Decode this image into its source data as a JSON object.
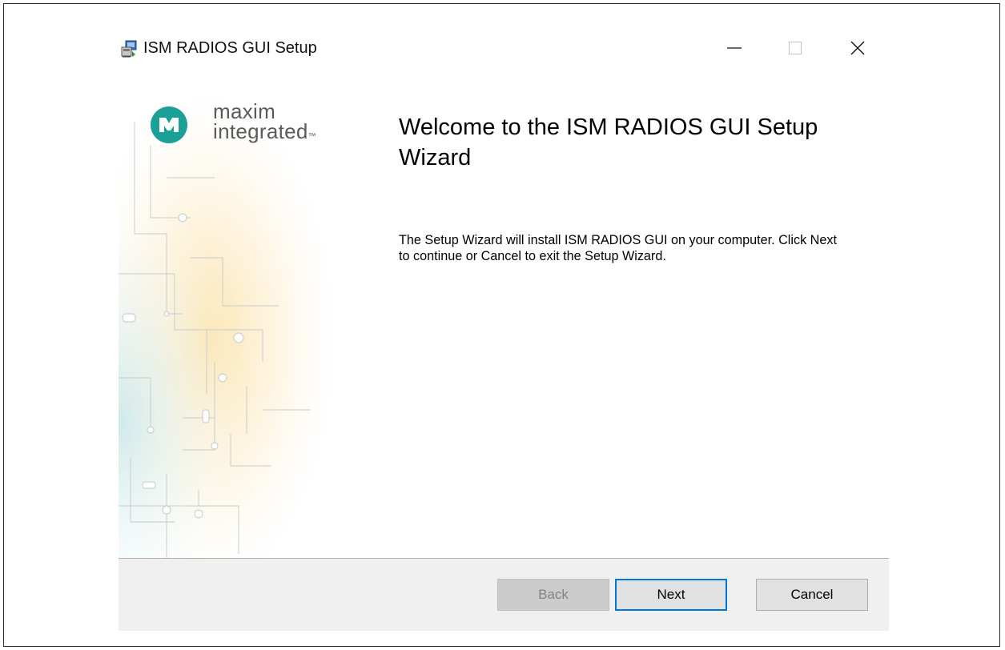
{
  "window": {
    "title": "ISM RADIOS GUI Setup",
    "controls": {
      "minimize": "minimize-icon",
      "maximize": "maximize-icon",
      "close": "close-icon"
    }
  },
  "branding": {
    "logo_line1": "maxim",
    "logo_line2": "integrated",
    "trademark": "™",
    "logo_color": "#1aa097"
  },
  "content": {
    "title": "Welcome to the ISM RADIOS GUI Setup Wizard",
    "body": "The Setup Wizard will install ISM RADIOS GUI on your computer. Click Next to continue or Cancel to exit the Setup Wizard."
  },
  "buttons": {
    "back": "Back",
    "next": "Next",
    "cancel": "Cancel"
  },
  "colors": {
    "focus_border": "#0078d7",
    "footer_bg": "#f0f0f0",
    "disabled_button_bg": "#cccccc"
  }
}
